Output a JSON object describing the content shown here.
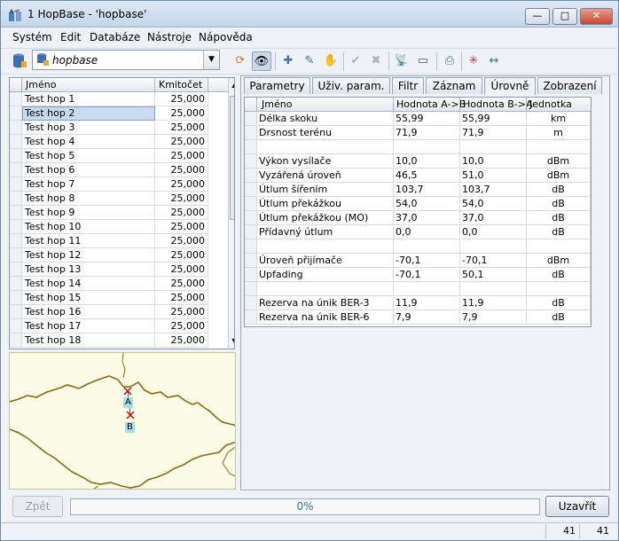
{
  "window": {
    "title": "1 HopBase - 'hopbase'",
    "min_label": "—",
    "max_label": "□",
    "close_label": "✕"
  },
  "menu": [
    "Systém",
    "Edit",
    "Databáze",
    "Nástroje",
    "Nápověda"
  ],
  "toolbar": {
    "database": "hopbase",
    "icons": [
      "database-icon",
      "refresh-icon",
      "eye-icon",
      "new-hop-icon",
      "edit-hop-icon",
      "hand-icon",
      "check-icon",
      "cancel-icon",
      "antenna-icon",
      "device-icon",
      "print-icon",
      "target-icon",
      "link-icon"
    ]
  },
  "hop_list": {
    "columns": [
      "Jméno",
      "Kmitočet"
    ],
    "selected_index": 1,
    "rows": [
      {
        "name": "Test hop 1",
        "freq": "25,000"
      },
      {
        "name": "Test hop 2",
        "freq": "25,000"
      },
      {
        "name": "Test hop 3",
        "freq": "25,000"
      },
      {
        "name": "Test hop 4",
        "freq": "25,000"
      },
      {
        "name": "Test hop 5",
        "freq": "25,000"
      },
      {
        "name": "Test hop 6",
        "freq": "25,000"
      },
      {
        "name": "Test hop 7",
        "freq": "25,000"
      },
      {
        "name": "Test hop 8",
        "freq": "25,000"
      },
      {
        "name": "Test hop 9",
        "freq": "25,000"
      },
      {
        "name": "Test hop 10",
        "freq": "25,000"
      },
      {
        "name": "Test hop 11",
        "freq": "25,000"
      },
      {
        "name": "Test hop 12",
        "freq": "25,000"
      },
      {
        "name": "Test hop 13",
        "freq": "25,000"
      },
      {
        "name": "Test hop 14",
        "freq": "25,000"
      },
      {
        "name": "Test hop 15",
        "freq": "25,000"
      },
      {
        "name": "Test hop 16",
        "freq": "25,000"
      },
      {
        "name": "Test hop 17",
        "freq": "25,000"
      },
      {
        "name": "Test hop 18",
        "freq": "25,000"
      }
    ]
  },
  "map": {
    "point_a": "A",
    "point_b": "B"
  },
  "tabs": [
    "Parametry",
    "Uživ. param.",
    "Filtr",
    "Záznam",
    "Úrovně",
    "Zobrazení"
  ],
  "active_tab": "Úrovně",
  "levels_table": {
    "columns": [
      "Jméno",
      "Hodnota A->B",
      "Hodnota B->A",
      "Jednotka"
    ],
    "rows": [
      {
        "name": "Délka skoku",
        "ab": "55,99",
        "ba": "55,99",
        "unit": "km"
      },
      {
        "name": "Drsnost terénu",
        "ab": "71,9",
        "ba": "71,9",
        "unit": "m"
      },
      {
        "name": "",
        "ab": "",
        "ba": "",
        "unit": ""
      },
      {
        "name": "Výkon vysílače",
        "ab": "10,0",
        "ba": "10,0",
        "unit": "dBm"
      },
      {
        "name": "Vyzářená úroveň",
        "ab": "46,5",
        "ba": "51,0",
        "unit": "dBm"
      },
      {
        "name": "Útlum šířením",
        "ab": "103,7",
        "ba": "103,7",
        "unit": "dB"
      },
      {
        "name": "Útlum překážkou",
        "ab": "54,0",
        "ba": "54,0",
        "unit": "dB"
      },
      {
        "name": "Útlum překážkou (MO)",
        "ab": "37,0",
        "ba": "37,0",
        "unit": "dB"
      },
      {
        "name": "Přídavný útlum",
        "ab": "0,0",
        "ba": "0,0",
        "unit": "dB"
      },
      {
        "name": "",
        "ab": "",
        "ba": "",
        "unit": ""
      },
      {
        "name": "Úroveň přijímače",
        "ab": "-70,1",
        "ba": "-70,1",
        "unit": "dBm"
      },
      {
        "name": "Upfading",
        "ab": "-70,1",
        "ba": "50,1",
        "unit": "dB"
      },
      {
        "name": "",
        "ab": "",
        "ba": "",
        "unit": ""
      },
      {
        "name": "Rezerva na únik BER-3",
        "ab": "11,9",
        "ba": "11,9",
        "unit": "dB"
      },
      {
        "name": "Rezerva na únik BER-6",
        "ab": "7,9",
        "ba": "7,9",
        "unit": "dB"
      }
    ]
  },
  "bottom": {
    "back_label": "Zpět",
    "progress": "0%",
    "close_label": "Uzavřít"
  },
  "statusbar": [
    "41",
    "41"
  ],
  "colors": {
    "selection": "#c9daf0",
    "accent": "#3a6ea8"
  }
}
